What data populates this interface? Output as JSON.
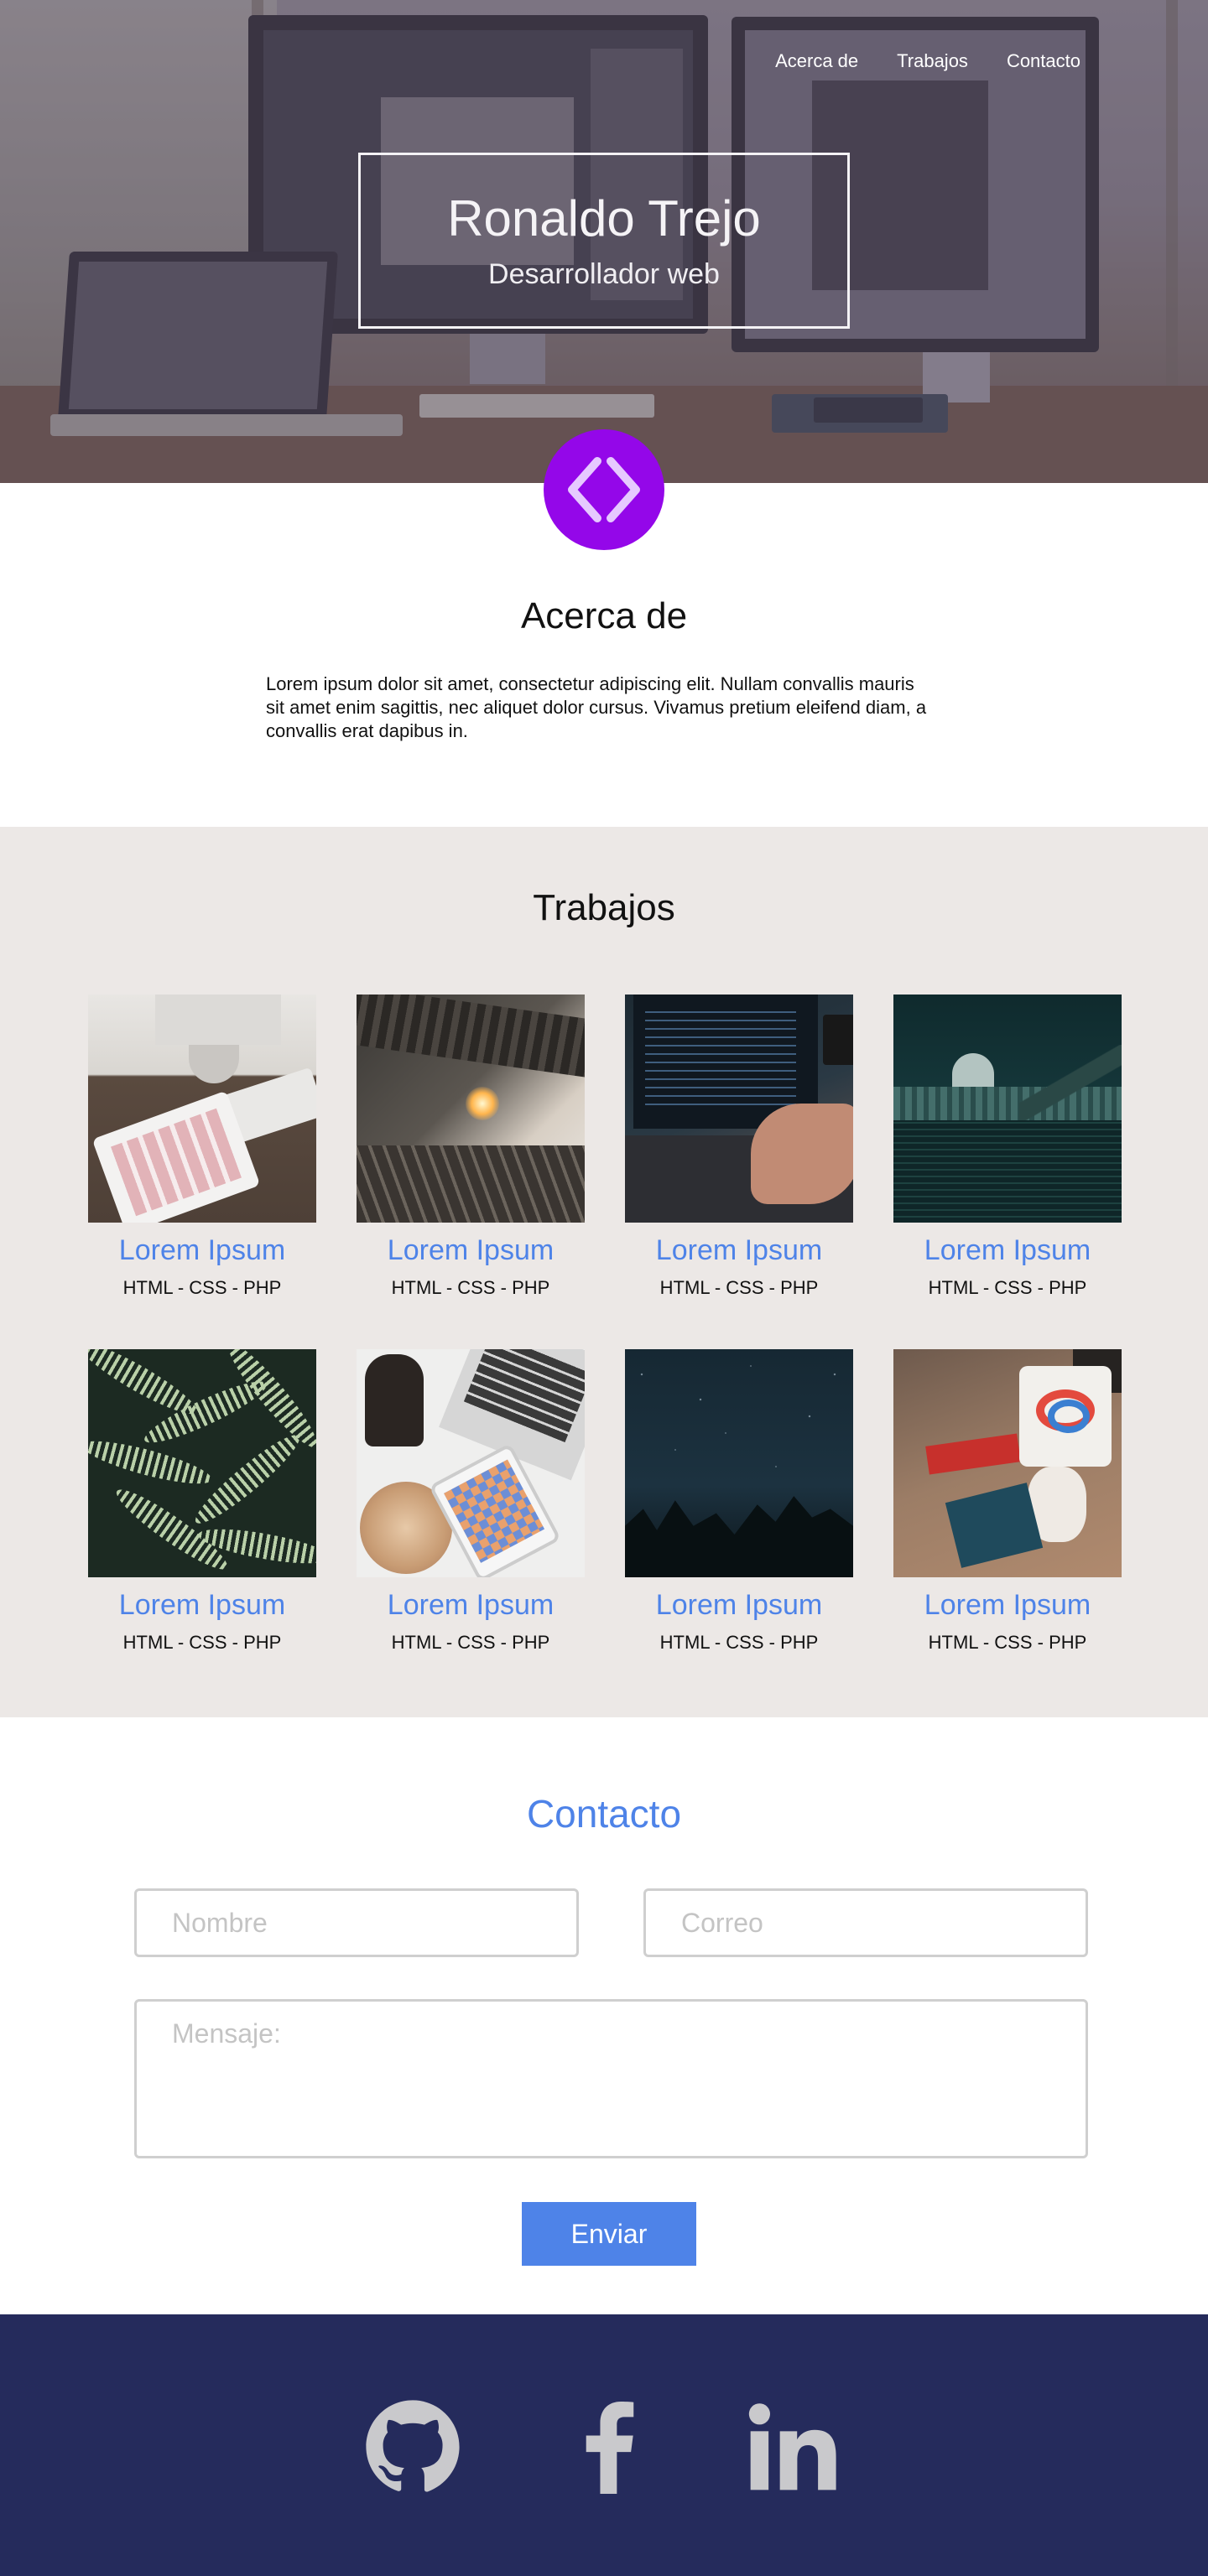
{
  "nav": {
    "items": [
      {
        "label": "Acerca de"
      },
      {
        "label": "Trabajos"
      },
      {
        "label": "Contacto"
      }
    ]
  },
  "hero": {
    "name": "Ronaldo Trejo",
    "role": "Desarrollador web",
    "badge_icon": "code-brackets-icon",
    "badge_color": "#9407e9"
  },
  "about": {
    "title": "Acerca de",
    "text": "Lorem ipsum dolor sit amet, consectetur adipiscing elit. Nullam convallis mauris sit amet enim sagittis, nec aliquet dolor cursus. Vivamus pretium eleifend diam, a convallis erat dapibus in."
  },
  "works": {
    "title": "Trabajos",
    "items": [
      {
        "name": "Lorem Ipsum",
        "tech": "HTML - CSS - PHP"
      },
      {
        "name": "Lorem Ipsum",
        "tech": "HTML - CSS - PHP"
      },
      {
        "name": "Lorem Ipsum",
        "tech": "HTML - CSS - PHP"
      },
      {
        "name": "Lorem Ipsum",
        "tech": "HTML - CSS - PHP"
      },
      {
        "name": "Lorem Ipsum",
        "tech": "HTML - CSS - PHP"
      },
      {
        "name": "Lorem Ipsum",
        "tech": "HTML - CSS - PHP"
      },
      {
        "name": "Lorem Ipsum",
        "tech": "HTML - CSS - PHP"
      },
      {
        "name": "Lorem Ipsum",
        "tech": "HTML - CSS - PHP"
      }
    ]
  },
  "contact": {
    "title": "Contacto",
    "name_placeholder": "Nombre",
    "email_placeholder": "Correo",
    "message_placeholder": "Mensaje:",
    "submit_label": "Enviar"
  },
  "footer": {
    "social": [
      {
        "icon": "github-icon"
      },
      {
        "icon": "facebook-icon"
      },
      {
        "icon": "linkedin-icon"
      }
    ]
  },
  "colors": {
    "accent": "#4e83e8",
    "works_bg": "#ece8e6",
    "footer_bg": "#252b5c",
    "footer_icon": "#c9c9cc"
  }
}
